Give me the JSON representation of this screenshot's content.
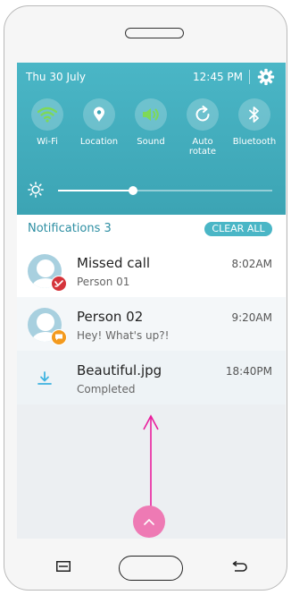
{
  "status": {
    "date": "Thu 30 July",
    "time": "12:45 PM"
  },
  "quick_settings": [
    {
      "label": "Wi-Fi",
      "icon": "wifi-icon",
      "active": true
    },
    {
      "label": "Location",
      "icon": "location-icon",
      "active": false
    },
    {
      "label": "Sound",
      "icon": "sound-icon",
      "active": true
    },
    {
      "label": "Auto\nrotate",
      "icon": "auto-rotate-icon",
      "active": false
    },
    {
      "label": "Bluetooth",
      "icon": "bluetooth-icon",
      "active": false
    }
  ],
  "brightness": {
    "level": 0.35
  },
  "notifications": {
    "title": "Notifications 3",
    "clear_all": "CLEAR ALL",
    "items": [
      {
        "title": "Missed call",
        "sub": "Person 01",
        "time": "8:02AM"
      },
      {
        "title": "Person 02",
        "sub": "Hey! What's up?!",
        "time": "9:20AM"
      },
      {
        "title": "Beautiful.jpg",
        "sub": "Completed",
        "time": "18:40PM"
      }
    ]
  },
  "colors": {
    "panel": "#3ca4b4",
    "active_tile": "#7ed957",
    "accent": "#2e8fa3",
    "missed_call_badge": "#d5343b",
    "message_badge": "#f39a1e",
    "gesture": "#ee7ab4"
  }
}
